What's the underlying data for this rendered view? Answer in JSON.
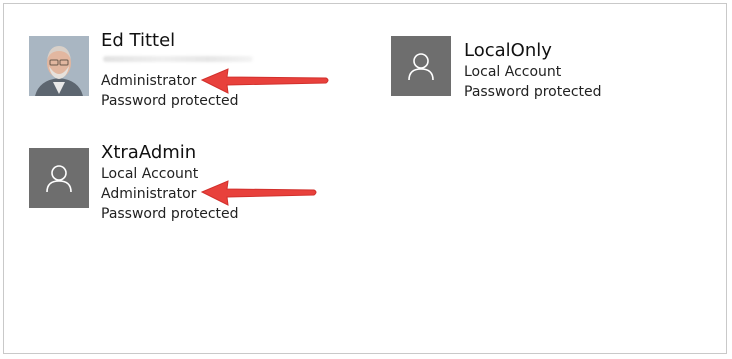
{
  "accounts": [
    {
      "name": "Ed Tittel",
      "lines": [
        "Administrator",
        "Password protected"
      ]
    },
    {
      "name": "LocalOnly",
      "lines": [
        "Local Account",
        "Password protected"
      ]
    },
    {
      "name": "XtraAdmin",
      "lines": [
        "Local Account",
        "Administrator",
        "Password protected"
      ]
    }
  ],
  "colors": {
    "avatar": "#6e6e6e",
    "arrow": "#e8413c",
    "frame": "#c9c9c9"
  },
  "icons": {
    "default_avatar": "person-outline-icon",
    "annotation": "red-arrow-icon"
  }
}
